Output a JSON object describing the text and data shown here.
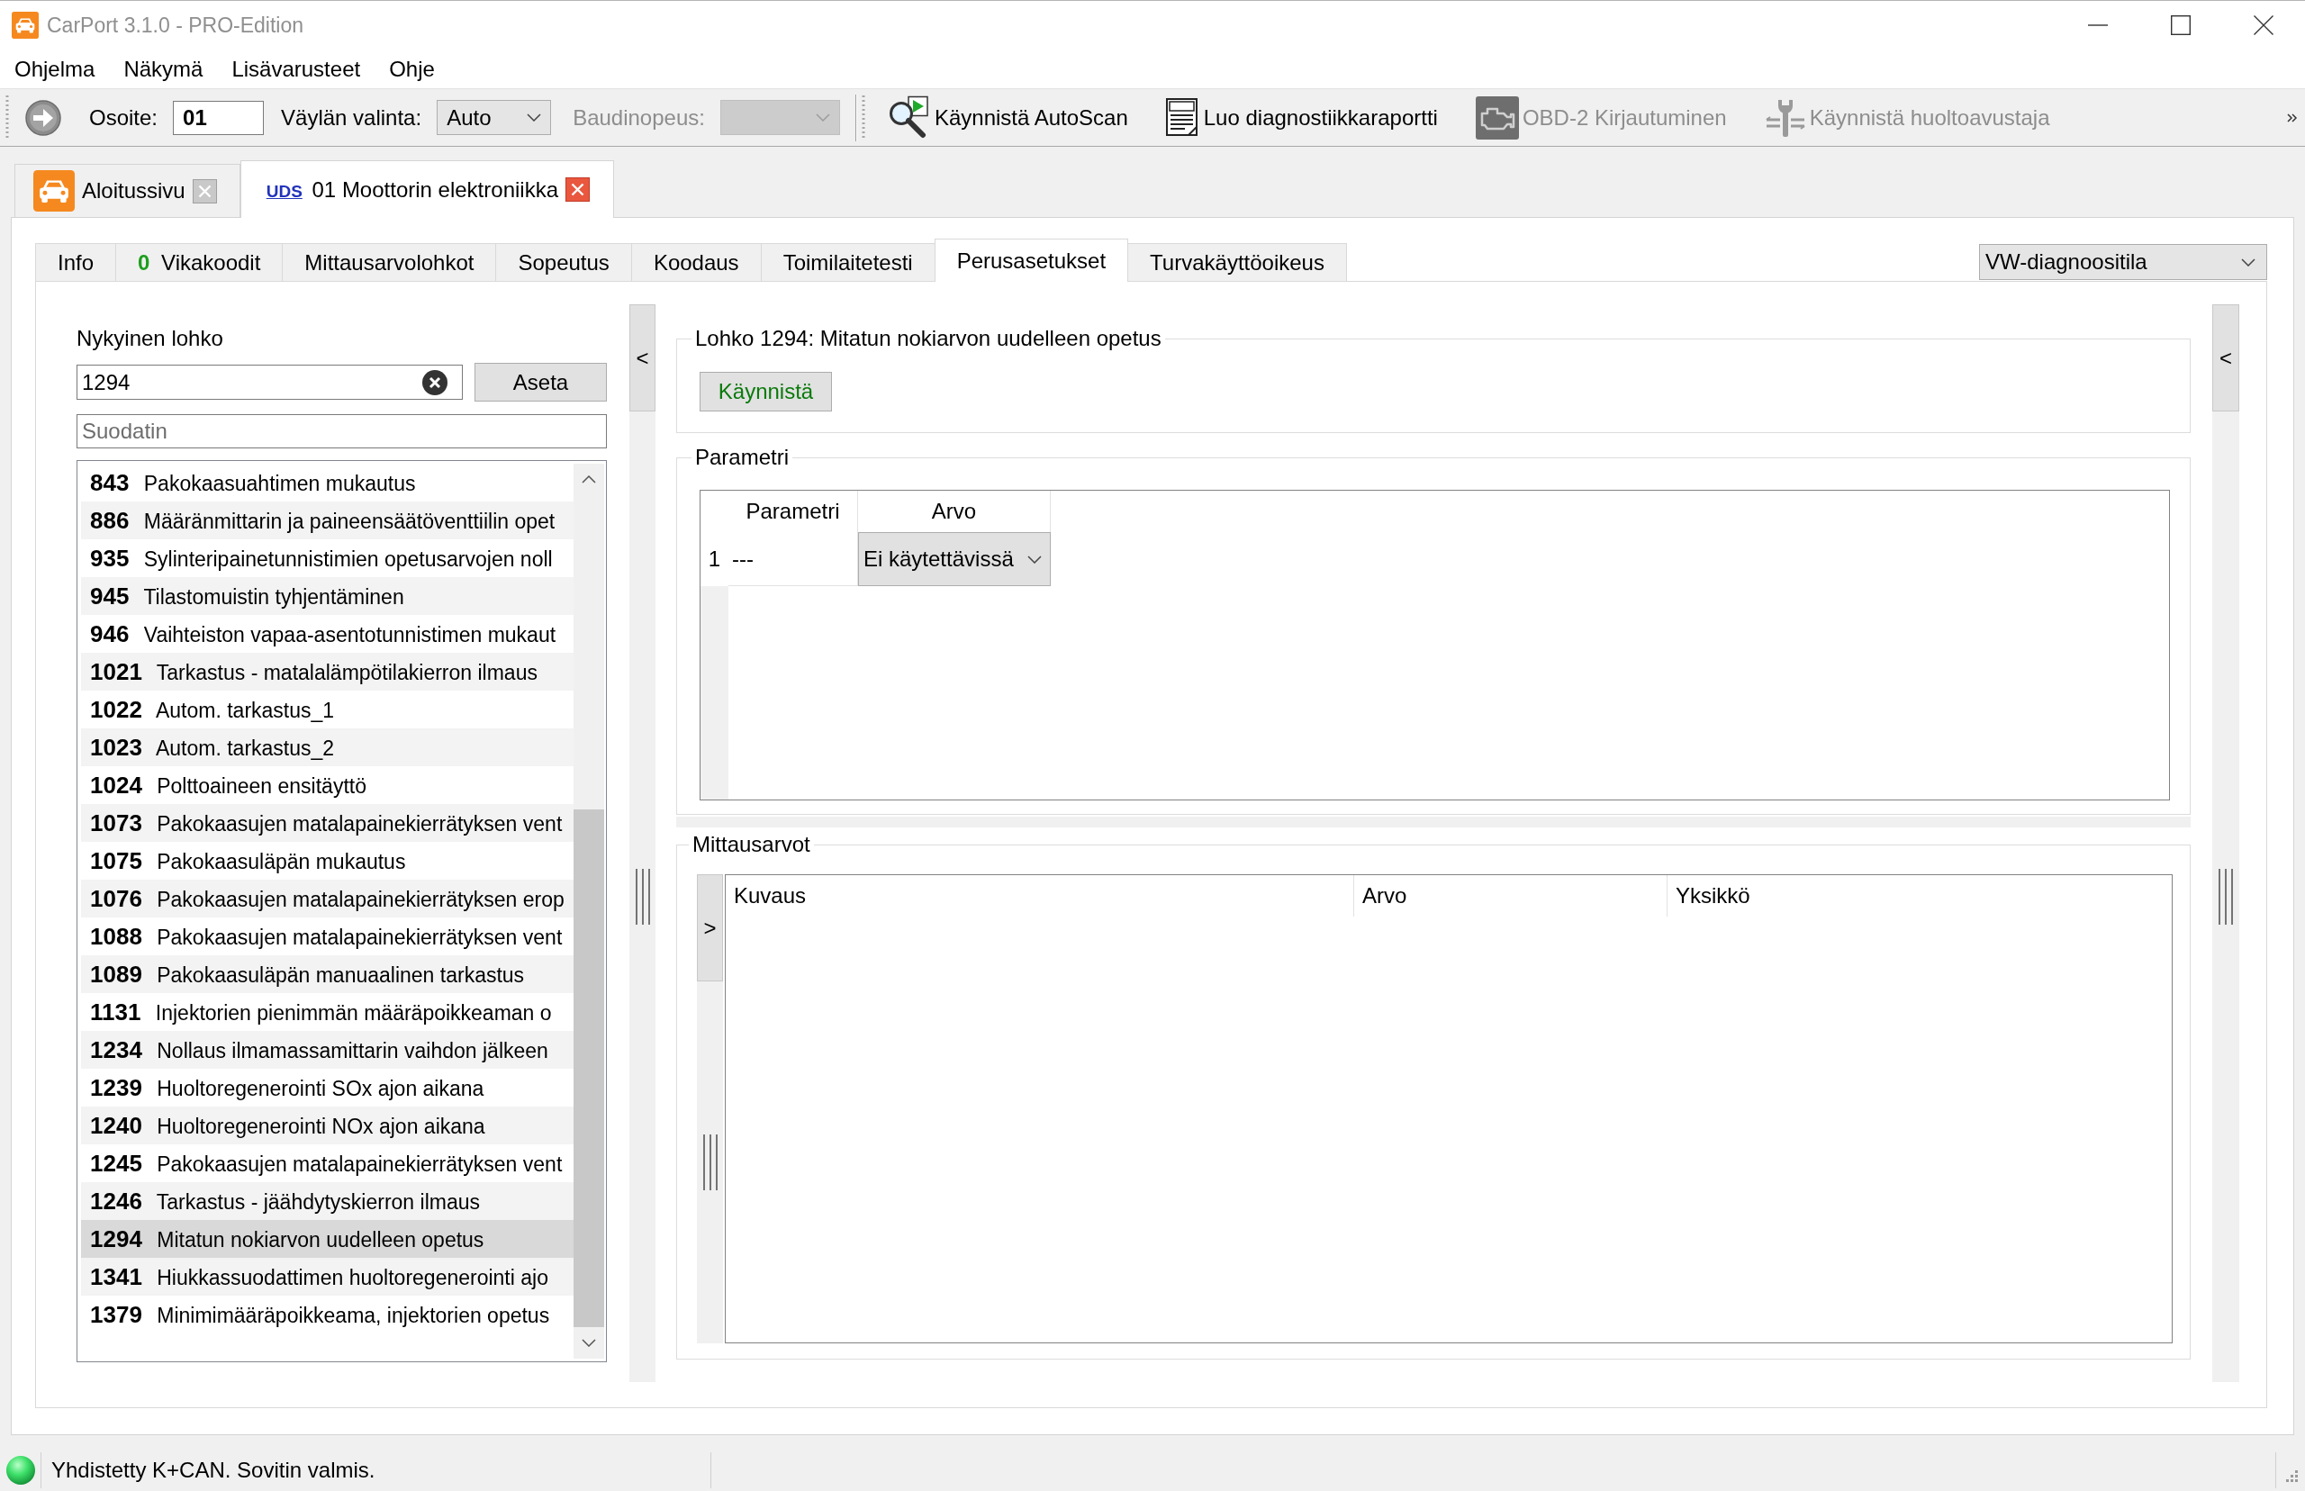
{
  "window": {
    "title": "CarPort 3.1.0 - PRO-Edition"
  },
  "menu": [
    "Ohjelma",
    "Näkymä",
    "Lisävarusteet",
    "Ohje"
  ],
  "toolbar": {
    "address": {
      "label": "Osoite:",
      "value": "01"
    },
    "bus": {
      "label": "Väylän valinta:",
      "value": "Auto"
    },
    "baud": {
      "label": "Baudinopeus:",
      "disabled": true
    },
    "actions": [
      {
        "kind": "scan",
        "label": "Käynnistä AutoScan",
        "disabled": false
      },
      {
        "kind": "report",
        "label": "Luo diagnostiikkaraportti",
        "disabled": false
      },
      {
        "kind": "login",
        "label": "OBD-2 Kirjautuminen",
        "disabled": true
      },
      {
        "kind": "service",
        "label": "Käynnistä huoltoavustaja",
        "disabled": true
      }
    ]
  },
  "document_tabs": [
    {
      "kind": "home",
      "label": "Aloitussivu",
      "selected": false
    },
    {
      "kind": "module",
      "protocol": "UDS",
      "label": "01 Moottorin elektroniikka",
      "selected": true
    }
  ],
  "tabs": [
    {
      "label": "Info",
      "selected": false
    },
    {
      "label": "Vikakoodit",
      "badge": "0",
      "selected": false
    },
    {
      "label": "Mittausarvolohkot",
      "selected": false
    },
    {
      "label": "Sopeutus",
      "selected": false
    },
    {
      "label": "Koodaus",
      "selected": false
    },
    {
      "label": "Toimilaitetesti",
      "selected": false
    },
    {
      "label": "Perusasetukset",
      "selected": true
    },
    {
      "label": "Turvakäyttöoikeus",
      "selected": false
    }
  ],
  "mode_select": {
    "value": "VW-diagnoositila"
  },
  "block_panel": {
    "label": "Nykyinen lohko",
    "value": "1294",
    "set_button": "Aseta",
    "filter": {
      "placeholder": "Suodatin"
    },
    "blocks": [
      {
        "number": "843",
        "name": "Pakokaasuahtimen mukautus",
        "selected": false
      },
      {
        "number": "886",
        "name": "Määränmittarin ja paineensäätöventtiilin opet",
        "selected": false
      },
      {
        "number": "935",
        "name": "Sylinteripainetunnistimien opetusarvojen noll",
        "selected": false
      },
      {
        "number": "945",
        "name": "Tilastomuistin tyhjentäminen",
        "selected": false
      },
      {
        "number": "946",
        "name": "Vaihteiston vapaa-asentotunnistimen mukaut",
        "selected": false
      },
      {
        "number": "1021",
        "name": "Tarkastus - matalalämpötilakierron ilmaus",
        "selected": false
      },
      {
        "number": "1022",
        "name": "Autom. tarkastus_1",
        "selected": false
      },
      {
        "number": "1023",
        "name": "Autom. tarkastus_2",
        "selected": false
      },
      {
        "number": "1024",
        "name": "Polttoaineen ensitäyttö",
        "selected": false
      },
      {
        "number": "1073",
        "name": "Pakokaasujen matalapainekierrätyksen vent",
        "selected": false
      },
      {
        "number": "1075",
        "name": "Pakokaasuläpän mukautus",
        "selected": false
      },
      {
        "number": "1076",
        "name": "Pakokaasujen matalapainekierrätyksen erop",
        "selected": false
      },
      {
        "number": "1088",
        "name": "Pakokaasujen matalapainekierrätyksen vent",
        "selected": false
      },
      {
        "number": "1089",
        "name": "Pakokaasuläpän manuaalinen tarkastus",
        "selected": false
      },
      {
        "number": "1131",
        "name": "Injektorien pienimmän määräpoikkeaman o",
        "selected": false
      },
      {
        "number": "1234",
        "name": "Nollaus ilmamassamittarin vaihdon jälkeen",
        "selected": false
      },
      {
        "number": "1239",
        "name": "Huoltoregenerointi SOx ajon aikana",
        "selected": false
      },
      {
        "number": "1240",
        "name": "Huoltoregenerointi NOx ajon aikana",
        "selected": false
      },
      {
        "number": "1245",
        "name": "Pakokaasujen matalapainekierrätyksen vent",
        "selected": false
      },
      {
        "number": "1246",
        "name": "Tarkastus - jäähdytyskierron ilmaus",
        "selected": false
      },
      {
        "number": "1294",
        "name": "Mitatun nokiarvon uudelleen opetus",
        "selected": true
      },
      {
        "number": "1341",
        "name": "Hiukkassuodattimen huoltoregenerointi ajo",
        "selected": false
      },
      {
        "number": "1379",
        "name": "Minimimääräpoikkeama, injektorien opetus",
        "selected": false
      }
    ]
  },
  "left_splitter": {
    "button": "<"
  },
  "block_group": {
    "title": "Lohko 1294: Mitatun nokiarvon uudelleen opetus",
    "start_button": "Käynnistä"
  },
  "parameters": {
    "title": "Parametri",
    "columns": [
      "Parametri",
      "Arvo"
    ],
    "rows": [
      {
        "index": "1",
        "parameter": "---",
        "value": "Ei käytettävissä"
      }
    ]
  },
  "measurements": {
    "title": "Mittausarvot",
    "expand_button": ">",
    "columns": [
      "Kuvaus",
      "Arvo",
      "Yksikkö"
    ]
  },
  "right_splitter": {
    "button": "<"
  },
  "status_bar": {
    "connected": true,
    "text": "Yhdistetty K+CAN. Sovitin valmis."
  }
}
